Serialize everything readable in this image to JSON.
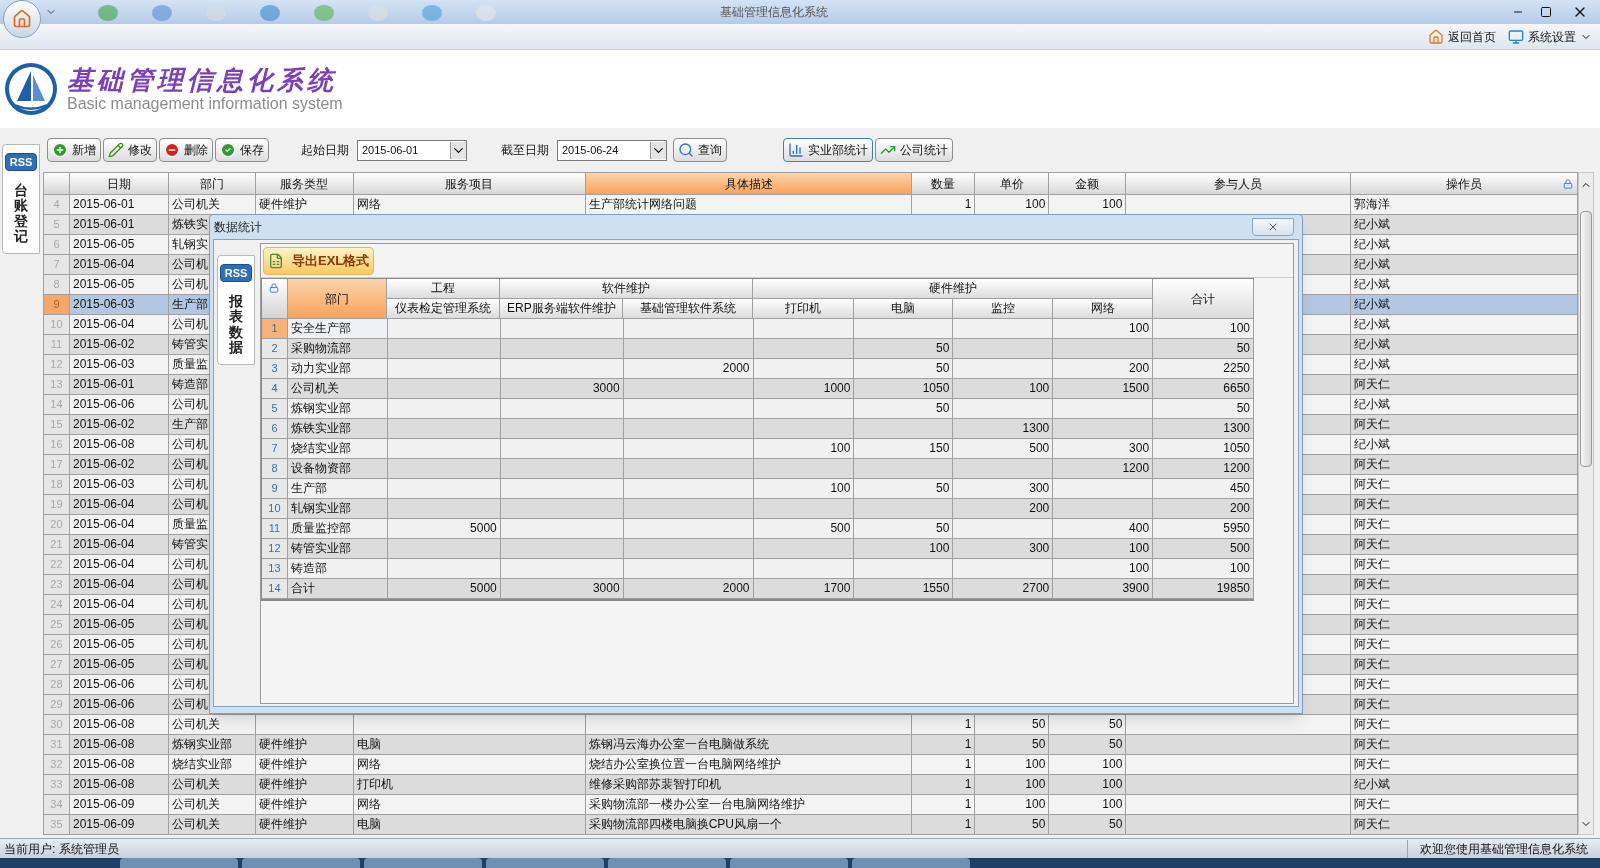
{
  "window": {
    "title": "基础管理信息化系统"
  },
  "menu": [
    {
      "label": "返回首页",
      "kind": "home"
    },
    {
      "label": "系统设置",
      "kind": "settings"
    }
  ],
  "header": {
    "title": "基础管理信息化系统",
    "subtitle": "Basic management information system"
  },
  "side_tab": {
    "badge": "RSS",
    "label": "台账登记"
  },
  "toolbar": {
    "buttons": [
      {
        "label": "新增",
        "kind": "add"
      },
      {
        "label": "修改",
        "kind": "edit"
      },
      {
        "label": "删除",
        "kind": "delete"
      },
      {
        "label": "保存",
        "kind": "save"
      }
    ],
    "start_date": {
      "label": "起始日期",
      "value": "2015-06-01"
    },
    "end_date": {
      "label": "截至日期",
      "value": "2015-06-24"
    },
    "query": "查询",
    "stats": [
      {
        "label": "实业部统计",
        "kind": "bar",
        "selected": true
      },
      {
        "label": "公司统计",
        "kind": "line",
        "selected": false
      }
    ]
  },
  "table": {
    "columns": [
      {
        "label": "日期",
        "selected": false
      },
      {
        "label": "部门",
        "selected": false
      },
      {
        "label": "服务类型",
        "selected": false
      },
      {
        "label": "服务项目",
        "selected": false
      },
      {
        "label": "具体描述",
        "selected": true
      },
      {
        "label": "数量",
        "selected": false
      },
      {
        "label": "单价",
        "selected": false
      },
      {
        "label": "金额",
        "selected": false
      },
      {
        "label": "参与人员",
        "selected": false
      },
      {
        "label": "操作员",
        "selected": false
      }
    ],
    "rows": [
      {
        "number": "4",
        "selected": false,
        "date": "2015-06-01",
        "department": "公司机关",
        "service_type": "硬件维护",
        "service_item": "网络",
        "description": "生产部统计网络问题",
        "quantity": "1",
        "unit_price": "100",
        "amount": "100",
        "operator": "郭海洋"
      },
      {
        "number": "5",
        "selected": false,
        "date": "2015-06-01",
        "department": "炼铁实",
        "operator": "纪小斌"
      },
      {
        "number": "6",
        "selected": false,
        "date": "2015-06-05",
        "department": "轧钢实",
        "operator": "纪小斌"
      },
      {
        "number": "7",
        "selected": false,
        "date": "2015-06-04",
        "department": "公司机",
        "operator": "纪小斌"
      },
      {
        "number": "8",
        "selected": false,
        "date": "2015-06-05",
        "department": "公司机",
        "operator": "纪小斌"
      },
      {
        "number": "9",
        "selected": true,
        "date": "2015-06-03",
        "department": "生产部",
        "operator": "纪小斌"
      },
      {
        "number": "10",
        "selected": false,
        "date": "2015-06-04",
        "department": "公司机",
        "operator": "纪小斌"
      },
      {
        "number": "11",
        "selected": false,
        "date": "2015-06-02",
        "department": "铸管实",
        "operator": "纪小斌"
      },
      {
        "number": "12",
        "selected": false,
        "date": "2015-06-03",
        "department": "质量监",
        "operator": "纪小斌"
      },
      {
        "number": "13",
        "selected": false,
        "date": "2015-06-01",
        "department": "铸造部",
        "operator": "阿天仁"
      },
      {
        "number": "14",
        "selected": false,
        "date": "2015-06-06",
        "department": "公司机",
        "operator": "纪小斌"
      },
      {
        "number": "15",
        "selected": false,
        "date": "2015-06-02",
        "department": "生产部",
        "operator": "阿天仁"
      },
      {
        "number": "16",
        "selected": false,
        "date": "2015-06-08",
        "department": "公司机",
        "operator": "纪小斌"
      },
      {
        "number": "17",
        "selected": false,
        "date": "2015-06-02",
        "department": "公司机",
        "operator": "阿天仁"
      },
      {
        "number": "18",
        "selected": false,
        "date": "2015-06-03",
        "department": "公司机",
        "operator": "阿天仁"
      },
      {
        "number": "19",
        "selected": false,
        "date": "2015-06-04",
        "department": "公司机",
        "operator": "阿天仁"
      },
      {
        "number": "20",
        "selected": false,
        "date": "2015-06-04",
        "department": "质量监",
        "operator": "阿天仁"
      },
      {
        "number": "21",
        "selected": false,
        "date": "2015-06-04",
        "department": "铸管实",
        "operator": "阿天仁"
      },
      {
        "number": "22",
        "selected": false,
        "date": "2015-06-04",
        "department": "公司机",
        "operator": "阿天仁"
      },
      {
        "number": "23",
        "selected": false,
        "date": "2015-06-04",
        "department": "公司机",
        "operator": "阿天仁"
      },
      {
        "number": "24",
        "selected": false,
        "date": "2015-06-04",
        "department": "公司机",
        "operator": "阿天仁"
      },
      {
        "number": "25",
        "selected": false,
        "date": "2015-06-05",
        "department": "公司机",
        "operator": "阿天仁"
      },
      {
        "number": "26",
        "selected": false,
        "date": "2015-06-05",
        "department": "公司机",
        "operator": "阿天仁"
      },
      {
        "number": "27",
        "selected": false,
        "date": "2015-06-05",
        "department": "公司机",
        "operator": "阿天仁"
      },
      {
        "number": "28",
        "selected": false,
        "date": "2015-06-06",
        "department": "公司机",
        "operator": "阿天仁"
      },
      {
        "number": "29",
        "selected": false,
        "date": "2015-06-06",
        "department": "公司机",
        "operator": "阿天仁"
      },
      {
        "number": "30",
        "selected": false,
        "date": "2015-06-08",
        "department": "公司机关",
        "quantity": "1",
        "unit_price": "50",
        "amount": "50",
        "operator": "阿天仁"
      },
      {
        "number": "31",
        "selected": false,
        "date": "2015-06-08",
        "department": "炼钢实业部",
        "service_type": "硬件维护",
        "service_item": "电脑",
        "description": "炼钢冯云海办公室一台电脑做系统",
        "quantity": "1",
        "unit_price": "50",
        "amount": "50",
        "operator": "阿天仁"
      },
      {
        "number": "32",
        "selected": false,
        "date": "2015-06-08",
        "department": "烧结实业部",
        "service_type": "硬件维护",
        "service_item": "网络",
        "description": "烧结办公室换位置一台电脑网络维护",
        "quantity": "1",
        "unit_price": "100",
        "amount": "100",
        "operator": "阿天仁"
      },
      {
        "number": "33",
        "selected": false,
        "date": "2015-06-08",
        "department": "公司机关",
        "service_type": "硬件维护",
        "service_item": "打印机",
        "description": "维修采购部苏裴智打印机",
        "quantity": "1",
        "unit_price": "100",
        "amount": "100",
        "operator": "纪小斌"
      },
      {
        "number": "34",
        "selected": false,
        "date": "2015-06-09",
        "department": "公司机关",
        "service_type": "硬件维护",
        "service_item": "网络",
        "description": "采购物流部一楼办公室一台电脑网络维护",
        "quantity": "1",
        "unit_price": "100",
        "amount": "100",
        "operator": "阿天仁"
      },
      {
        "number": "35",
        "selected": false,
        "date": "2015-06-09",
        "department": "公司机关",
        "service_type": "硬件维护",
        "service_item": "电脑",
        "description": "采购物流部四楼电脑换CPU风扇一个",
        "quantity": "1",
        "unit_price": "50",
        "amount": "50",
        "operator": "阿天仁"
      }
    ]
  },
  "dialog": {
    "title": "数据统计",
    "side_tab": {
      "badge": "RSS",
      "label": "报表数据"
    },
    "export_button": "导出EXL格式",
    "grid": {
      "department_header": "部门",
      "total_header": "合计",
      "groups": [
        {
          "label": "工程",
          "columns": [
            "仪表检定管理系统"
          ]
        },
        {
          "label": "软件维护",
          "columns": [
            "ERP服务端软件维护",
            "基础管理软件系统"
          ]
        },
        {
          "label": "硬件维护",
          "columns": [
            "打印机",
            "电脑",
            "监控",
            "网络"
          ]
        }
      ],
      "rows": [
        {
          "number": "1",
          "selected": true,
          "department": "安全生产部",
          "network": "100",
          "total": "100"
        },
        {
          "number": "2",
          "selected": false,
          "department": "采购物流部",
          "computer": "50",
          "total": "50"
        },
        {
          "number": "3",
          "selected": false,
          "department": "动力实业部",
          "base_software": "2000",
          "computer": "50",
          "network": "200",
          "total": "2250"
        },
        {
          "number": "4",
          "selected": false,
          "department": "公司机关",
          "erp_software": "3000",
          "printer": "1000",
          "computer": "1050",
          "monitoring": "100",
          "network": "1500",
          "total": "6650"
        },
        {
          "number": "5",
          "selected": false,
          "department": "炼钢实业部",
          "computer": "50",
          "total": "50"
        },
        {
          "number": "6",
          "selected": false,
          "department": "炼铁实业部",
          "monitoring": "1300",
          "total": "1300"
        },
        {
          "number": "7",
          "selected": false,
          "department": "烧结实业部",
          "printer": "100",
          "computer": "150",
          "monitoring": "500",
          "network": "300",
          "total": "1050"
        },
        {
          "number": "8",
          "selected": false,
          "department": "设备物资部",
          "network": "1200",
          "total": "1200"
        },
        {
          "number": "9",
          "selected": false,
          "department": "生产部",
          "printer": "100",
          "computer": "50",
          "monitoring": "300",
          "total": "450"
        },
        {
          "number": "10",
          "selected": false,
          "department": "轧钢实业部",
          "monitoring": "200",
          "total": "200"
        },
        {
          "number": "11",
          "selected": false,
          "department": "质量监控部",
          "instrument_system": "5000",
          "printer": "500",
          "computer": "50",
          "network": "400",
          "total": "5950"
        },
        {
          "number": "12",
          "selected": false,
          "department": "铸管实业部",
          "computer": "100",
          "monitoring": "300",
          "network": "100",
          "total": "500"
        },
        {
          "number": "13",
          "selected": false,
          "department": "铸造部",
          "network": "100",
          "total": "100"
        },
        {
          "number": "14",
          "selected": false,
          "department": "合计",
          "instrument_system": "5000",
          "erp_software": "3000",
          "base_software": "2000",
          "printer": "1700",
          "computer": "1550",
          "monitoring": "2700",
          "network": "3900",
          "total": "19850"
        }
      ]
    }
  },
  "status_bar": {
    "user": "当前用户: 系统管理员",
    "welcome": "欢迎您使用基础管理信息化系统"
  }
}
